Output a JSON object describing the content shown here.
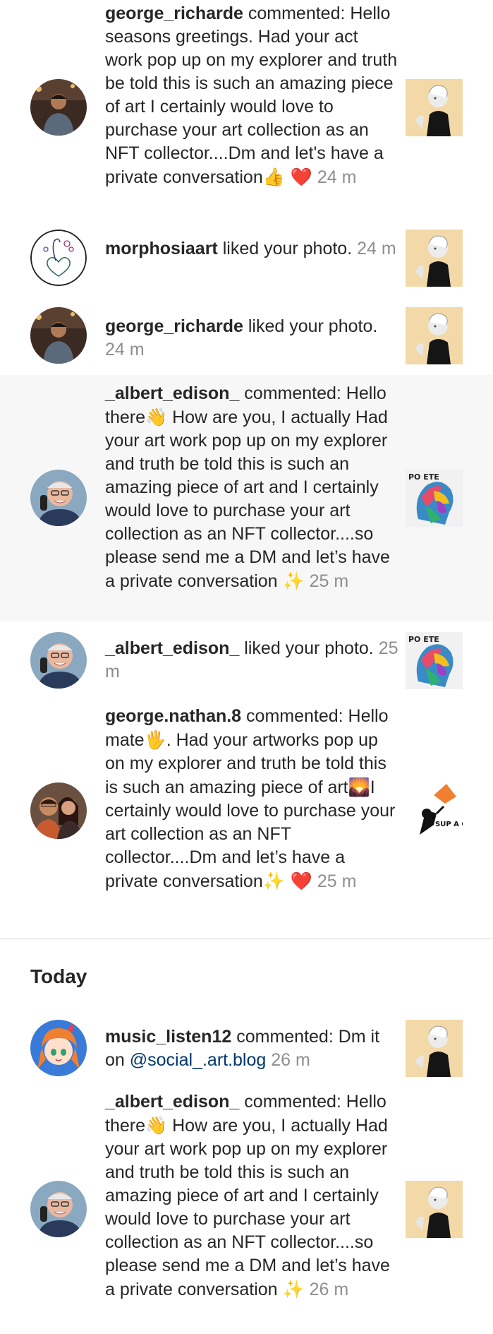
{
  "section": {
    "today_label": "Today"
  },
  "notifications": [
    {
      "username": "george_richarde",
      "action": " commented: Hello seasons greetings. Had your act work pop up on my explorer and truth be told this is such an amazing piece of art I certainly would love to purchase your art collection as an NFT collector....Dm and let's have a private conversation",
      "emoji": "👍 ❤️",
      "time": "24 m",
      "avatar_icon": "avatar-man-restaurant",
      "thumb_icon": "thumb-statue-art"
    },
    {
      "username": "morphosiaart",
      "action": " liked your photo.",
      "time": "24 m",
      "avatar_icon": "avatar-peacock-heart-drawing",
      "thumb_icon": "thumb-statue-art"
    },
    {
      "username": "george_richarde",
      "action": " liked your photo.",
      "time": "24 m",
      "avatar_icon": "avatar-man-restaurant",
      "thumb_icon": "thumb-statue-art"
    },
    {
      "username": "_albert_edison_",
      "action": " commented: Hello there",
      "emoji_wave": "👋",
      "action_2": " How are you, I actually Had your art work pop up on my explorer and truth be told this is such an amazing piece of art and I certainly would love to purchase your art collection as an NFT collector....so please send me a DM and let’s have a private conversation ",
      "emoji_end": "✨",
      "time": "25 m",
      "avatar_icon": "avatar-older-man-phone",
      "thumb_icon": "thumb-colorful-head-art"
    },
    {
      "username": "_albert_edison_",
      "action": " liked your photo.",
      "time": "25 m",
      "avatar_icon": "avatar-older-man-phone",
      "thumb_icon": "thumb-colorful-head-art"
    },
    {
      "username": "george.nathan.8",
      "action": " commented: Hello mate",
      "emoji_hand": "🖐",
      "action_2": ". Had your artworks pop up on my explorer and truth be told this is such an amazing piece of art",
      "emoji_art": "🌄",
      "action_3": "I certainly would love to purchase your art collection as an NFT collector....Dm and let’s have a private conversation",
      "emoji_end": "✨ ❤️",
      "time": "25 m",
      "avatar_icon": "avatar-couple-selfie",
      "thumb_icon": "thumb-sup-a-chip"
    },
    {
      "username": "music_listen12",
      "action": " commented: Dm it on ",
      "mention": "@social_.art.blog",
      "time": "26 m",
      "avatar_icon": "avatar-anime-girl",
      "thumb_icon": "thumb-statue-art"
    },
    {
      "username": "_albert_edison_",
      "action": " commented: Hello there",
      "emoji_wave": "👋",
      "action_2": " How are you, I actually Had your art work pop up on my explorer and truth be told this is such an amazing piece of art and I certainly would love to purchase your art collection as an NFT collector....so please send me a DM and let’s have a private conversation ",
      "emoji_end": "✨",
      "time": "26 m",
      "avatar_icon": "avatar-older-man-phone",
      "thumb_icon": "thumb-statue-art"
    }
  ],
  "thumb_text": {
    "sup_chip": "SUP A CHIP",
    "po_ete": "PO ETE"
  }
}
